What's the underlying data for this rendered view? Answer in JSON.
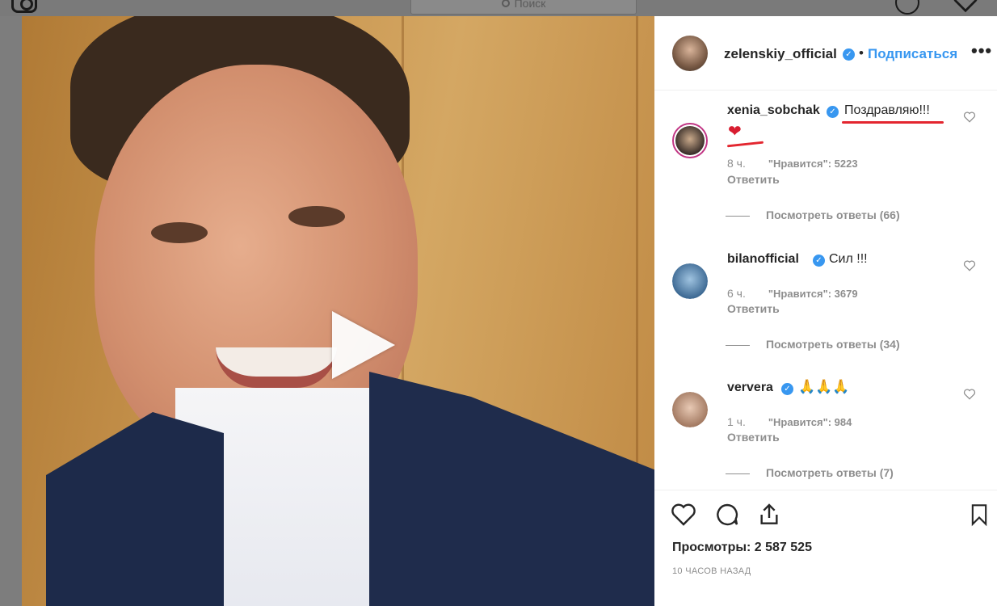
{
  "topbar": {
    "search_placeholder": "Поиск"
  },
  "post": {
    "author": "zelenskiy_official",
    "follow_label": "Подписаться",
    "dot": "•",
    "more_label": "•••",
    "views_label": "Просмотры: 2 587 525",
    "time_ago": "10 ЧАСОВ НАЗАД"
  },
  "comments": [
    {
      "username": "xenia_sobchak",
      "text": "Поздравляю!!!",
      "emoji": "❤",
      "time": "8 ч.",
      "likes": "\"Нравится\": 5223",
      "reply": "Ответить",
      "view_replies": "Посмотреть ответы (66)"
    },
    {
      "username": "bilanofficial",
      "text": "Сил !!!",
      "time": "6 ч.",
      "likes": "\"Нравится\": 3679",
      "reply": "Ответить",
      "view_replies": "Посмотреть ответы (34)"
    },
    {
      "username": "ververa",
      "text": "🙏🙏🙏",
      "time": "1 ч.",
      "likes": "\"Нравится\": 984",
      "reply": "Ответить",
      "view_replies": "Посмотреть ответы (7)"
    }
  ],
  "colors": {
    "accent": "#3897f0",
    "text": "#262626",
    "muted": "#8e8e8e",
    "highlight": "#e3262f"
  }
}
